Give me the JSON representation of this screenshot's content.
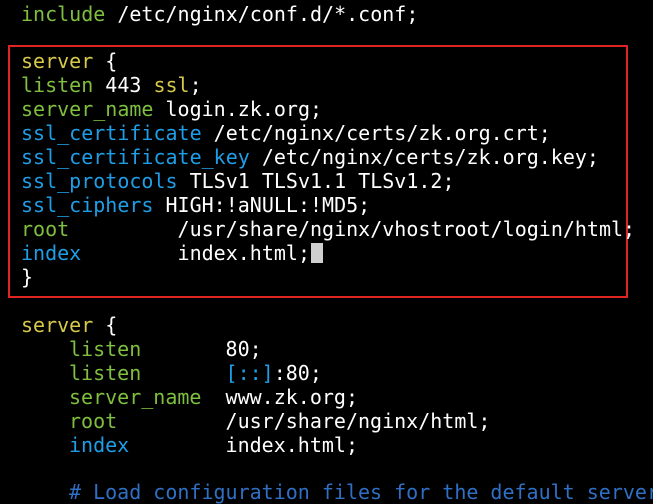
{
  "lines": {
    "include": {
      "kw": "include",
      "rest": " /etc/nginx/conf.d/*.conf;"
    },
    "server1_open": {
      "kw": "server",
      "rest": " {"
    },
    "listen1": {
      "kw": "listen",
      "n": " 443 ",
      "ssl": "ssl",
      "end": ";"
    },
    "server_name1": {
      "kw": "server_name",
      "rest": " login.zk.org;"
    },
    "ssl_cert": {
      "kw": "ssl_certificate",
      "rest": " /etc/nginx/certs/zk.org.crt;"
    },
    "ssl_cert_key": {
      "kw": "ssl_certificate_key",
      "rest": " /etc/nginx/certs/zk.org.key;"
    },
    "ssl_protocols": {
      "kw": "ssl_protocols",
      "rest": " TLSv1 TLSv1.1 TLSv1.2;"
    },
    "ssl_ciphers": {
      "kw": "ssl_ciphers",
      "rest": " HIGH:!aNULL:!MD5;"
    },
    "root1": {
      "kw": "root",
      "rest": "         /usr/share/nginx/vhostroot/login/html;"
    },
    "index1": {
      "kw": "index",
      "rest": "        index.html;"
    },
    "server1_close": {
      "text": "}"
    },
    "server2_open": {
      "kw": "server",
      "rest": " {"
    },
    "listen2a": {
      "kw": "listen",
      "rest": "       80;"
    },
    "listen2b": {
      "kw": "listen",
      "pad": "       ",
      "bracket": "[::]",
      "rest": ":80;"
    },
    "server_name2": {
      "kw": "server_name",
      "rest": "  www.zk.org;"
    },
    "root2": {
      "kw": "root",
      "rest": "         /usr/share/nginx/html;"
    },
    "index2": {
      "kw": "index",
      "rest": "        index.html;"
    },
    "comment": {
      "text": "# Load configuration files for the default server"
    }
  },
  "colors": {
    "background": "#000000",
    "keyword": "#7fbf3f",
    "ssl_flag": "#d7c94a",
    "blue_keyword": "#1e9ee6",
    "comment": "#2f70c4",
    "highlight_border": "#e02323"
  }
}
